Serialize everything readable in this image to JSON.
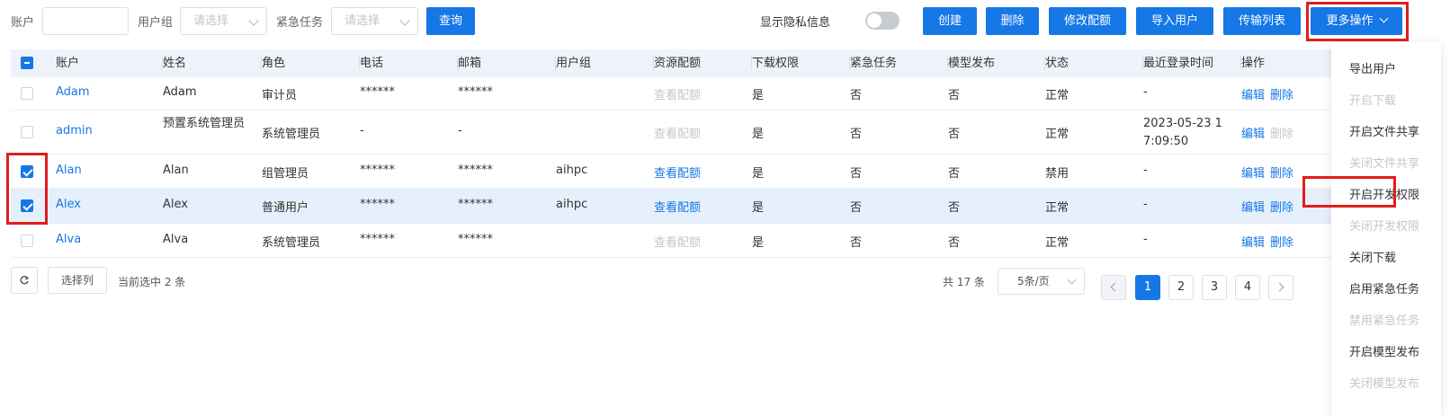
{
  "colors": {
    "primary": "#1677e6",
    "header_bg": "#eef3fb",
    "selected_row_bg": "#e6f0fc",
    "disabled": "#c4c7cc",
    "annotation": "#e01e1e"
  },
  "filters": {
    "account_label": "账户",
    "account_value": "",
    "usergroup_label": "用户组",
    "usergroup_placeholder": "请选择",
    "urgent_label": "紧急任务",
    "urgent_placeholder": "请选择",
    "query_button": "查询"
  },
  "privacy": {
    "label": "显示隐私信息",
    "enabled": false
  },
  "actions": {
    "create": "创建",
    "delete": "删除",
    "edit_quota": "修改配额",
    "import_users": "导入用户",
    "transfer_list": "传输列表",
    "more_actions": "更多操作"
  },
  "table": {
    "columns": [
      "账户",
      "姓名",
      "角色",
      "电话",
      "邮箱",
      "用户组",
      "资源配额",
      "下载权限",
      "紧急任务",
      "模型发布",
      "状态",
      "最近登录时间",
      "操作"
    ],
    "rows": [
      {
        "checked": false,
        "account": "Adam",
        "name": "Adam",
        "role": "审计员",
        "phone": "******",
        "email": "******",
        "group": "",
        "quota": "查看配额",
        "quota_enabled": false,
        "download": "是",
        "urgent": "否",
        "model_publish": "否",
        "status": "正常",
        "last_login": "-",
        "edit": "编辑",
        "delete": "删除",
        "delete_enabled": true
      },
      {
        "checked": false,
        "account": "admin",
        "name": "预置系统管理员",
        "role": "系统管理员",
        "phone": "-",
        "email": "-",
        "group": "",
        "quota": "查看配额",
        "quota_enabled": false,
        "download": "是",
        "urgent": "否",
        "model_publish": "否",
        "status": "正常",
        "last_login": "2023-05-23 17:09:50",
        "edit": "编辑",
        "delete": "删除",
        "delete_enabled": false
      },
      {
        "checked": true,
        "account": "Alan",
        "name": "Alan",
        "role": "组管理员",
        "phone": "******",
        "email": "******",
        "group": "aihpc",
        "quota": "查看配额",
        "quota_enabled": true,
        "download": "是",
        "urgent": "否",
        "model_publish": "否",
        "status": "禁用",
        "last_login": "-",
        "edit": "编辑",
        "delete": "删除",
        "delete_enabled": true
      },
      {
        "checked": true,
        "account": "Alex",
        "name": "Alex",
        "role": "普通用户",
        "phone": "******",
        "email": "******",
        "group": "aihpc",
        "quota": "查看配额",
        "quota_enabled": true,
        "download": "是",
        "urgent": "否",
        "model_publish": "否",
        "status": "正常",
        "last_login": "-",
        "edit": "编辑",
        "delete": "删除",
        "delete_enabled": true
      },
      {
        "checked": false,
        "account": "Alva",
        "name": "Alva",
        "role": "系统管理员",
        "phone": "******",
        "email": "******",
        "group": "",
        "quota": "查看配额",
        "quota_enabled": false,
        "download": "是",
        "urgent": "否",
        "model_publish": "否",
        "status": "正常",
        "last_login": "-",
        "edit": "编辑",
        "delete": "删除",
        "delete_enabled": true
      }
    ]
  },
  "footer": {
    "select_columns": "选择列",
    "selection_info": "当前选中 2 条",
    "total": "共 17 条",
    "page_size": "5条/页",
    "pages": [
      "1",
      "2",
      "3",
      "4"
    ],
    "current_page": "1"
  },
  "more_menu": [
    {
      "label": "导出用户",
      "enabled": true
    },
    {
      "label": "开启下载",
      "enabled": false
    },
    {
      "label": "开启文件共享",
      "enabled": true
    },
    {
      "label": "关闭文件共享",
      "enabled": false
    },
    {
      "label": "开启开发权限",
      "enabled": true
    },
    {
      "label": "关闭开发权限",
      "enabled": false
    },
    {
      "label": "关闭下载",
      "enabled": true
    },
    {
      "label": "启用紧急任务",
      "enabled": true
    },
    {
      "label": "禁用紧急任务",
      "enabled": false
    },
    {
      "label": "开启模型发布",
      "enabled": true
    },
    {
      "label": "关闭模型发布",
      "enabled": false
    }
  ]
}
